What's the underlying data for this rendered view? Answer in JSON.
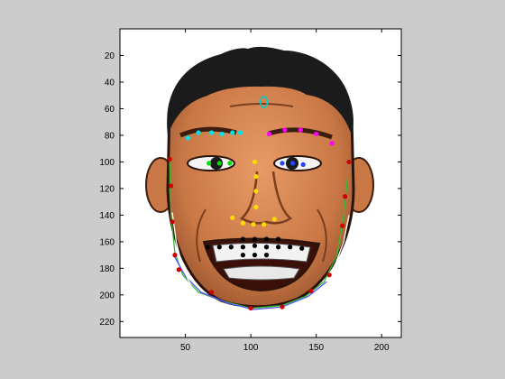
{
  "figure": {
    "background": "#cccccc",
    "axes_background": "#ffffff"
  },
  "axes": {
    "xlim": [
      0,
      215
    ],
    "ylim": [
      232,
      0
    ],
    "x_ticks": [
      50,
      100,
      150,
      200
    ],
    "y_ticks": [
      20,
      40,
      60,
      80,
      100,
      120,
      140,
      160,
      180,
      200,
      220
    ],
    "y_direction": "reversed"
  },
  "image": {
    "content": "cartoon smiling man face with facial landmark overlay"
  },
  "landmark_groups": [
    {
      "name": "forehead-marker",
      "color": "#00cccc",
      "shape": "circle-outline",
      "points": [
        [
          110,
          55
        ]
      ]
    },
    {
      "name": "left-eyebrow",
      "color": "#00e5e5",
      "shape": "dot",
      "points": [
        [
          52,
          82
        ],
        [
          60,
          78
        ],
        [
          70,
          78
        ],
        [
          78,
          79
        ],
        [
          86,
          78
        ],
        [
          92,
          78
        ]
      ]
    },
    {
      "name": "right-eyebrow",
      "color": "#ff00ff",
      "shape": "dot",
      "points": [
        [
          114,
          79
        ],
        [
          126,
          76
        ],
        [
          138,
          76
        ],
        [
          150,
          79
        ],
        [
          162,
          86
        ]
      ]
    },
    {
      "name": "left-eye",
      "color": "#00dd00",
      "shape": "dot",
      "points": [
        [
          68,
          101
        ],
        [
          76,
          101
        ],
        [
          84,
          101
        ]
      ]
    },
    {
      "name": "right-eye",
      "color": "#2244ff",
      "shape": "dot",
      "points": [
        [
          124,
          101
        ],
        [
          132,
          101
        ],
        [
          140,
          102
        ]
      ]
    },
    {
      "name": "nose-bridge",
      "color": "#ffdd00",
      "shape": "dot",
      "points": [
        [
          103,
          100
        ],
        [
          104,
          111
        ],
        [
          104,
          122
        ],
        [
          104,
          134
        ]
      ]
    },
    {
      "name": "nose-base",
      "color": "#ffdd00",
      "shape": "dot",
      "points": [
        [
          86,
          142
        ],
        [
          94,
          146
        ],
        [
          102,
          147
        ],
        [
          110,
          147
        ],
        [
          118,
          143
        ]
      ]
    },
    {
      "name": "mouth",
      "color": "#000000",
      "shape": "dot",
      "points": [
        [
          67,
          164
        ],
        [
          76,
          164
        ],
        [
          85,
          164
        ],
        [
          94,
          164
        ],
        [
          103,
          163
        ],
        [
          112,
          164
        ],
        [
          121,
          164
        ],
        [
          130,
          164
        ],
        [
          139,
          165
        ],
        [
          94,
          158
        ],
        [
          103,
          158
        ],
        [
          112,
          158
        ],
        [
          121,
          158
        ],
        [
          94,
          170
        ],
        [
          103,
          170
        ],
        [
          112,
          170
        ]
      ]
    },
    {
      "name": "jaw-points",
      "color": "#cc0000",
      "shape": "dot",
      "points": [
        [
          38,
          98
        ],
        [
          39,
          118
        ],
        [
          40,
          145
        ],
        [
          42,
          170
        ],
        [
          45,
          181
        ],
        [
          70,
          198
        ],
        [
          100,
          210
        ],
        [
          124,
          209
        ],
        [
          146,
          197
        ],
        [
          160,
          185
        ],
        [
          170,
          148
        ],
        [
          172,
          126
        ],
        [
          175,
          100
        ]
      ]
    }
  ],
  "contour_lines": [
    {
      "name": "jaw-outline-green",
      "color": "#33bb33",
      "points": [
        [
          38,
          100
        ],
        [
          39,
          140
        ],
        [
          42,
          168
        ],
        [
          48,
          185
        ],
        [
          60,
          198
        ],
        [
          80,
          205
        ],
        [
          100,
          210
        ],
        [
          124,
          208
        ],
        [
          142,
          201
        ],
        [
          156,
          190
        ],
        [
          166,
          170
        ],
        [
          171,
          140
        ],
        [
          174,
          112
        ]
      ]
    },
    {
      "name": "jaw-outline-blue",
      "color": "#5555ff",
      "points": [
        [
          41,
          170
        ],
        [
          50,
          186
        ],
        [
          62,
          198
        ],
        [
          82,
          206
        ],
        [
          102,
          211
        ],
        [
          124,
          209
        ],
        [
          144,
          201
        ],
        [
          158,
          190
        ]
      ]
    },
    {
      "name": "cheek-line-left",
      "color": "#ffffff",
      "points": [
        [
          40,
          138
        ],
        [
          43,
          160
        ],
        [
          48,
          180
        ],
        [
          55,
          194
        ]
      ]
    },
    {
      "name": "cheek-line-right",
      "color": "#ffffff",
      "points": [
        [
          158,
          190
        ],
        [
          165,
          176
        ],
        [
          171,
          160
        ],
        [
          175,
          140
        ]
      ]
    }
  ]
}
